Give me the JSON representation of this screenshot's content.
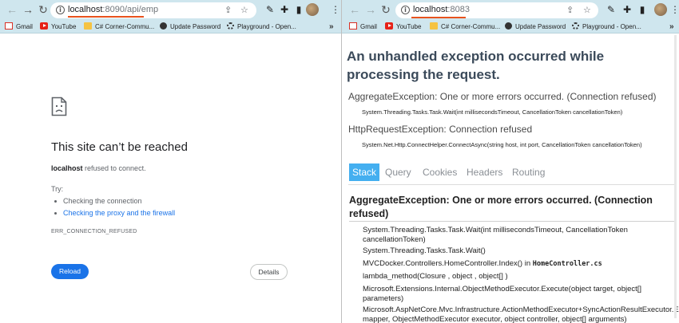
{
  "bookmarks": [
    {
      "label": "Gmail",
      "icon": "gmail-icon"
    },
    {
      "label": "YouTube",
      "icon": "youtube-icon"
    },
    {
      "label": "C# Corner-Commu...",
      "icon": "folder-icon"
    },
    {
      "label": "Update Password",
      "icon": "globe-icon"
    },
    {
      "label": "Playground - Open...",
      "icon": "gear-icon"
    }
  ],
  "bookmarks_more": "»",
  "left_browser": {
    "url_host": "localhost",
    "url_rest": ":8090/api/emp",
    "page": {
      "title": "This site can’t be reached",
      "host": "localhost",
      "message_rest": " refused to connect.",
      "try_label": "Try:",
      "suggestions": [
        "Checking the connection",
        "Checking the proxy and the firewall"
      ],
      "error_code": "ERR_CONNECTION_REFUSED",
      "reload_label": "Reload",
      "details_label": "Details"
    }
  },
  "right_browser": {
    "url_host": "localhost",
    "url_rest": ":8083",
    "page": {
      "title": "An unhandled exception occurred while processing the request.",
      "exceptions": [
        {
          "message": "AggregateException: One or more errors occurred. (Connection refused)",
          "location": "System.Threading.Tasks.Task.Wait(int millisecondsTimeout, CancellationToken cancellationToken)"
        },
        {
          "message": "HttpRequestException: Connection refused",
          "location": "System.Net.Http.ConnectHelper.ConnectAsync(string host, int port, CancellationToken cancellationToken)"
        }
      ],
      "tabs": [
        "Stack",
        "Query",
        "Cookies",
        "Headers",
        "Routing"
      ],
      "active_tab": "Stack",
      "stack_title": "AggregateException: One or more errors occurred. (Connection refused)",
      "frames": [
        {
          "text": "System.Threading.Tasks.Task.Wait(int millisecondsTimeout, CancellationToken cancellationToken)"
        },
        {
          "text": "System.Threading.Tasks.Task.Wait()"
        },
        {
          "text": "MVCDocker.Controllers.HomeController.Index() in ",
          "file": "HomeController.cs"
        },
        {
          "text": "lambda_method(Closure , object , object[] )"
        },
        {
          "text": "Microsoft.Extensions.Internal.ObjectMethodExecutor.Execute(object target, object[] parameters)"
        },
        {
          "text": "Microsoft.AspNetCore.Mvc.Infrastructure.ActionMethodExecutor+SyncActionResultExecutor.Execute(IActionResultTypeMapper mapper, ObjectMethodExecutor executor, object controller, object[] arguments)"
        }
      ]
    }
  },
  "colors": {
    "chrome_bar": "#cfe6ee",
    "url_underline": "#e8531e",
    "reload_blue": "#1a73e8",
    "active_tab": "#44aff0",
    "error_heading": "#3b4a5a"
  }
}
